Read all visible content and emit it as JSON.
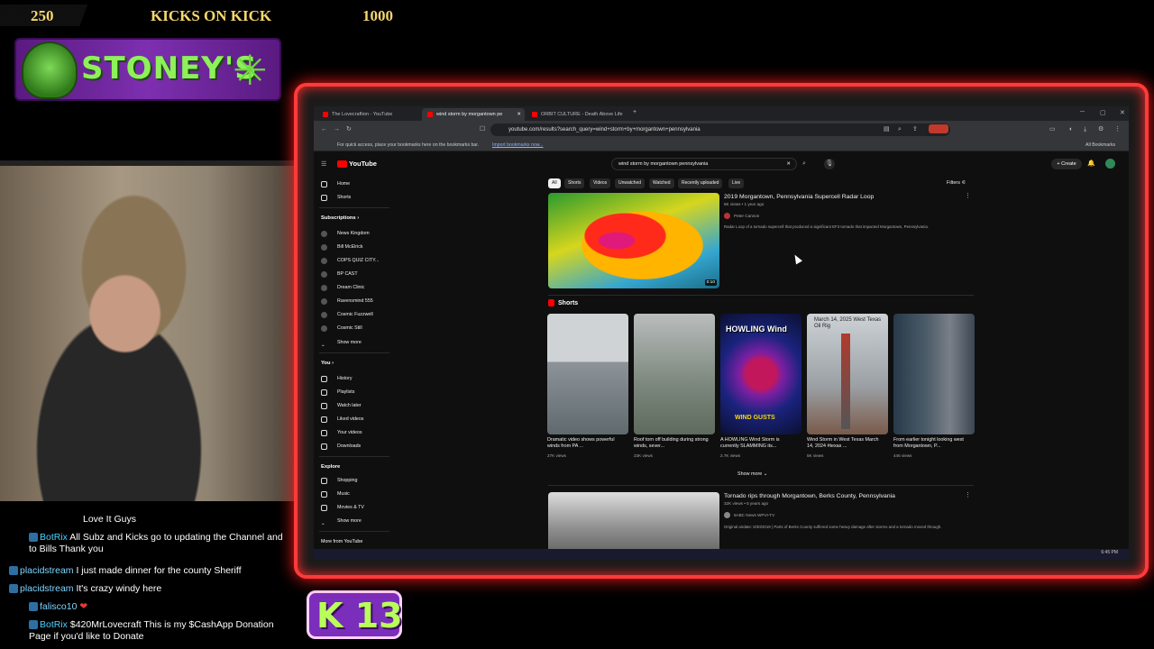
{
  "overlay": {
    "follower_count": "250",
    "kick_label": "KICKS ON KICK",
    "kick_goal": "1000",
    "banner_title": "STONEY'S",
    "kick_badge": "13"
  },
  "chat": [
    {
      "user": "",
      "message": "Love It Guys",
      "bot": false
    },
    {
      "user": "BotRix",
      "message": "All Subz and Kicks go to updating the Channel and to Bills Thank you",
      "bot": true
    },
    {
      "user": "placidstream",
      "message": "I just made dinner for the county Sheriff",
      "bot": false
    },
    {
      "user": "placidstream",
      "message": "It's crazy windy here",
      "bot": false
    },
    {
      "user": "falisco10",
      "message": "❤",
      "bot": false
    },
    {
      "user": "BotRix",
      "message": "$420MrLovecraft This is my $CashApp Donation Page if you'd like to Donate",
      "bot": true
    }
  ],
  "browser": {
    "tabs": [
      {
        "label": "The Lovecraftion - YouTube"
      },
      {
        "label": "wind storm by morgantown pe"
      },
      {
        "label": "ORBIT CULTURE - Death Above Life"
      }
    ],
    "url": "youtube.com/results?search_query=wind+storm+by+morgantown+pennsylvania",
    "bookmarks_text": "For quick access, place your bookmarks here on the bookmarks bar.",
    "bookmarks_link": "Import bookmarks now...",
    "all_bookmarks": "All Bookmarks"
  },
  "youtube": {
    "logo": "YouTube",
    "search_value": "wind storm by morgantown pennsylvania",
    "create_label": "+ Create",
    "sidebar": {
      "home": "Home",
      "shorts": "Shorts",
      "subscriptions_header": "Subscriptions",
      "subscriptions": [
        "News Kingdom",
        "Bill McElrick",
        "COPS QUIZ CITY...",
        "BP CAST",
        "Dream Clinic",
        "Ravensmind 555",
        "Cosmic Fuzzwell",
        "Cosmic Still"
      ],
      "show_more": "Show more",
      "you_header": "You",
      "you_items": [
        "History",
        "Playlists",
        "Watch later",
        "Liked videos",
        "Your videos",
        "Downloads"
      ],
      "explore_header": "Explore",
      "explore_items": [
        "Shopping",
        "Music",
        "Movies & TV"
      ],
      "explore_show_more": "Show more",
      "more_from": "More from YouTube"
    },
    "chips": [
      "All",
      "Shorts",
      "Videos",
      "Unwatched",
      "Watched",
      "Recently uploaded",
      "Live"
    ],
    "filters_label": "Filters",
    "video1": {
      "title": "2019 Morgantown, Pennsylvania Supercell Radar Loop",
      "meta": "6K views • 1 year ago",
      "channel": "Peter Cannon",
      "description": "Radar Loop of a tornado supercell that produced a significant EF3 tornado that impacted Morgantown, Pennsylvania.",
      "duration": "0:10"
    },
    "shorts_header": "Shorts",
    "shorts": [
      {
        "title": "Dramatic video shows powerful winds from PA ...",
        "views": "27K views"
      },
      {
        "title": "Roof torn off building during strong winds, sever...",
        "views": "23K views"
      },
      {
        "title": "A HOWLING Wind Storm is currently SLAMMING its...",
        "views": "2.7K views"
      },
      {
        "title": "Wind Storm in West Texas March 14, 2024 #texas ...",
        "views": "5K views"
      },
      {
        "title": "From earlier tonight looking west from Morgantown, P...",
        "views": "446 views"
      }
    ],
    "short3_overlay": "HOWLING Wind",
    "short3_bottom": "WIND GUSTS",
    "short4_overlay": "March 14, 2025 West Texas Oil Rig",
    "show_more": "Show more",
    "video2": {
      "title": "Tornado rips through Morgantown, Berks County, Pennsylvania",
      "meta": "32K views • 5 years ago",
      "channel": "6ABC News WPVI-TV",
      "description": "Original airdate: 5/30/2019 | Parts of Berks County suffered some heavy damage after storms and a tornado moved through."
    },
    "tray_time": "6:45 PM"
  }
}
